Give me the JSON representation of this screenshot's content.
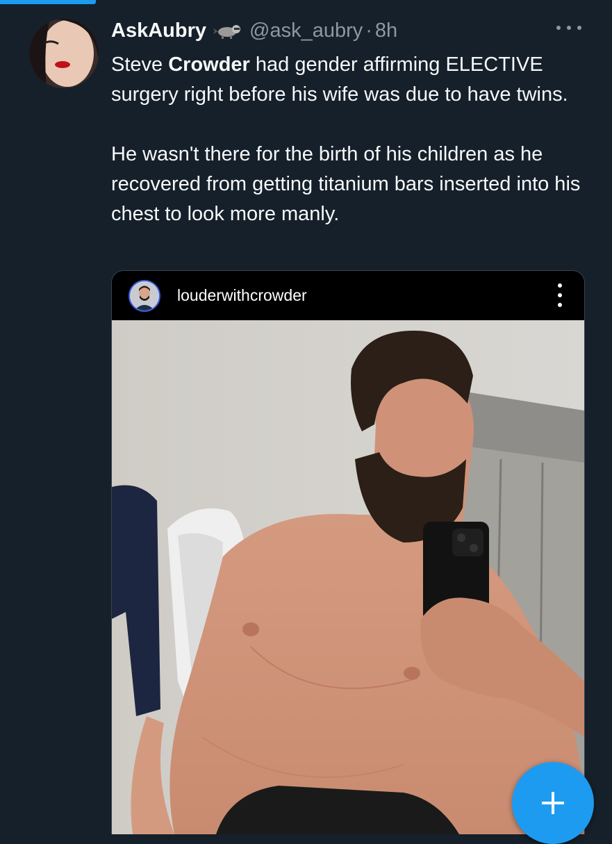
{
  "tweet": {
    "display_name": "AskAubry",
    "badge_icon": "raccoon-icon",
    "handle": "@ask_aubry",
    "separator": "·",
    "time": "8h",
    "text_part1_pre": "Steve ",
    "text_part1_bold": "Crowder",
    "text_part1_post": " had gender affirming ELECTIVE surgery right before his wife was due to have twins.",
    "text_part2": "He wasn't there for the birth of his children as he recovered from getting titanium bars inserted into his chest to look more manly."
  },
  "embedded_post": {
    "username": "louderwithcrowder",
    "more_icon": "vertical-ellipsis-icon"
  },
  "fab": {
    "icon": "plus-icon"
  },
  "colors": {
    "background": "#15202b",
    "accent": "#1d9bf0",
    "text_primary": "#f7f9f9",
    "text_secondary": "#8b98a5"
  }
}
